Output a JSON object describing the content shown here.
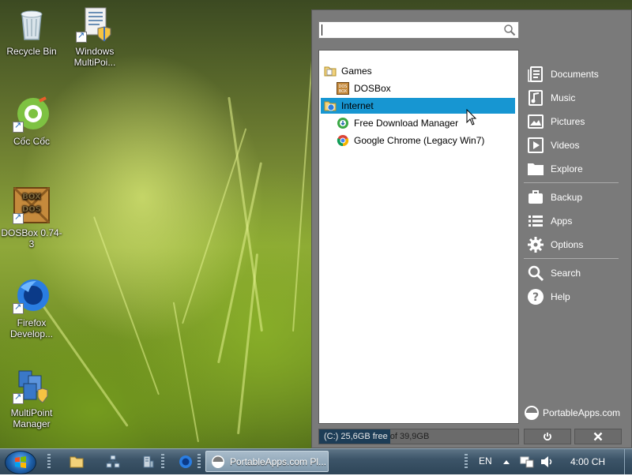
{
  "desktop": {
    "icons": [
      {
        "label": "Recycle Bin",
        "icon": "recycle-bin-icon"
      },
      {
        "label": "Windows MultiPoi...",
        "icon": "multipoint-doc-icon"
      },
      {
        "label": "Cốc Cốc",
        "icon": "coccoc-icon"
      },
      {
        "label": "DOSBox 0.74-3",
        "icon": "dosbox-icon"
      },
      {
        "label": "Firefox Develop...",
        "icon": "firefox-dev-icon"
      },
      {
        "label": "MultiPoint Manager",
        "icon": "multipoint-manager-icon"
      }
    ]
  },
  "menu": {
    "search": {
      "value": "",
      "placeholder": ""
    },
    "tree": [
      {
        "label": "Games",
        "level": 0,
        "icon": "folder-icon",
        "selected": false
      },
      {
        "label": "DOSBox",
        "level": 1,
        "icon": "dosbox-icon",
        "selected": false
      },
      {
        "label": "Internet",
        "level": 0,
        "icon": "internet-folder-icon",
        "selected": true
      },
      {
        "label": "Free Download Manager",
        "level": 1,
        "icon": "fdm-icon",
        "selected": false
      },
      {
        "label": "Google Chrome (Legacy Win7)",
        "level": 1,
        "icon": "chrome-icon",
        "selected": false
      }
    ],
    "right_items": [
      {
        "label": "Documents",
        "icon": "documents-icon"
      },
      {
        "label": "Music",
        "icon": "music-icon"
      },
      {
        "label": "Pictures",
        "icon": "pictures-icon"
      },
      {
        "label": "Videos",
        "icon": "videos-icon"
      },
      {
        "label": "Explore",
        "icon": "folder-icon"
      },
      {
        "label": "Backup",
        "icon": "briefcase-icon"
      },
      {
        "label": "Apps",
        "icon": "apps-list-icon"
      },
      {
        "label": "Options",
        "icon": "gear-icon"
      },
      {
        "label": "Search",
        "icon": "search-icon"
      },
      {
        "label": "Help",
        "icon": "help-icon"
      }
    ],
    "brand": "PortableApps.com",
    "drive": {
      "free_text": "(C:) 25,6GB free",
      "total_text": " of 39,9GB",
      "used_fraction": 0.358
    },
    "power_icon": "power-icon",
    "close_icon": "close-icon"
  },
  "taskbar": {
    "task_label": "PortableApps.com Pl...",
    "language": "EN",
    "clock": "4:00 CH"
  }
}
